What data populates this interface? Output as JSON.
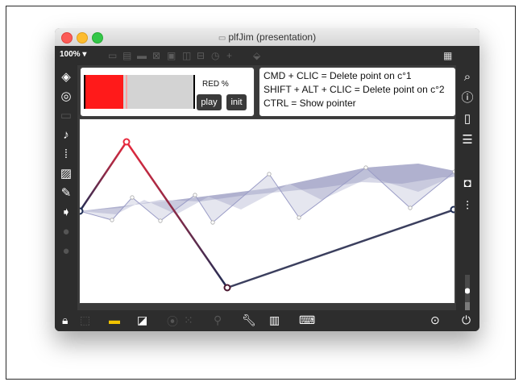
{
  "window": {
    "title": "plfJim (presentation)",
    "doc_icon": "▭"
  },
  "toolbar": {
    "zoom": "100% ▾"
  },
  "panel_left": {
    "red_label": "RED %",
    "red_value_percent": 36,
    "play_label": "play",
    "init_label": "init"
  },
  "panel_help": {
    "lines": [
      "CMD + CLIC = Delete point on c°1",
      "SHIFT + ALT + CLIC = Delete point on c°2",
      "CTRL = Show pointer"
    ]
  },
  "graph": {
    "colors": {
      "curve1_start": "#1f2d55",
      "curve1_end": "#e8283c",
      "curve2_start": "#e8283c",
      "curve2_end": "#1f2d55",
      "band": "#6e72a8"
    }
  }
}
